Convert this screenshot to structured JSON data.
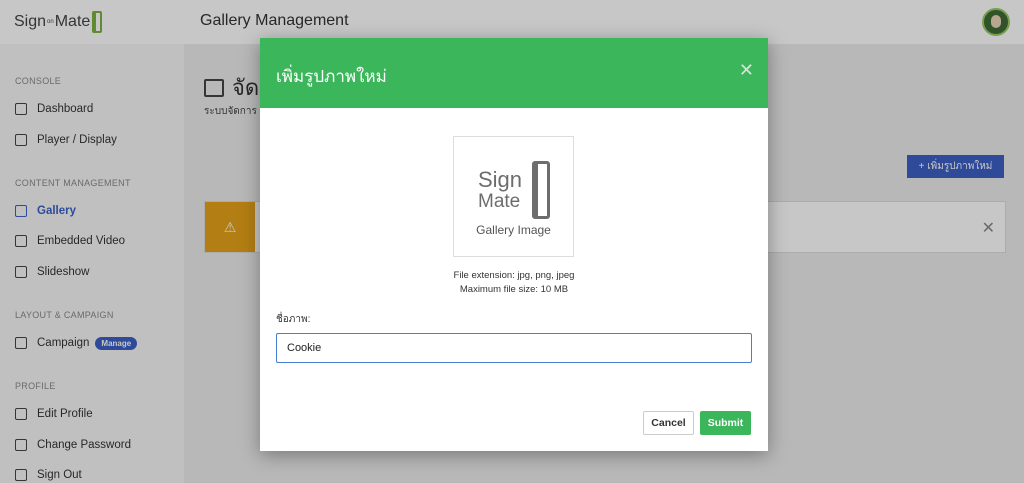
{
  "app": {
    "logo_left": "Sign",
    "logo_mid": "on",
    "logo_right": "Mate",
    "page_title": "Gallery Management"
  },
  "sidebar": {
    "sections": [
      {
        "title": "CONSOLE",
        "items": [
          {
            "label": "Dashboard",
            "icon": "home-icon"
          },
          {
            "label": "Player / Display",
            "icon": "display-icon"
          }
        ]
      },
      {
        "title": "CONTENT MANAGEMENT",
        "items": [
          {
            "label": "Gallery",
            "icon": "gallery-icon",
            "active": true
          },
          {
            "label": "Embedded Video",
            "icon": "video-icon"
          },
          {
            "label": "Slideshow",
            "icon": "slideshow-icon"
          }
        ]
      },
      {
        "title": "LAYOUT & CAMPAIGN",
        "items": [
          {
            "label": "Campaign",
            "icon": "campaign-icon",
            "badge": "Manage"
          }
        ]
      },
      {
        "title": "PROFILE",
        "items": [
          {
            "label": "Edit Profile",
            "icon": "info-icon"
          },
          {
            "label": "Change Password",
            "icon": "key-icon"
          },
          {
            "label": "Sign Out",
            "icon": "signout-icon"
          }
        ]
      }
    ]
  },
  "main": {
    "title": "จัดการ",
    "subtitle": "ระบบจัดการ",
    "add_button": "+ เพิ่มรูปภาพใหม่",
    "alert_close": "✕"
  },
  "modal": {
    "title": "เพิ่มรูปภาพใหม่",
    "close": "✕",
    "thumb": {
      "line1": "Sign",
      "line2": "Mate",
      "caption": "Gallery Image"
    },
    "hint_ext": "File extension: jpg, png, jpeg",
    "hint_size": "Maximum file size: 10 MB",
    "name_label": "ชื่อภาพ:",
    "name_value": "Cookie",
    "cancel_label": "Cancel",
    "submit_label": "Submit"
  },
  "colors": {
    "header_green": "#3cb65b",
    "accent_blue": "#3b5fc4",
    "warn": "#e6a21a"
  }
}
